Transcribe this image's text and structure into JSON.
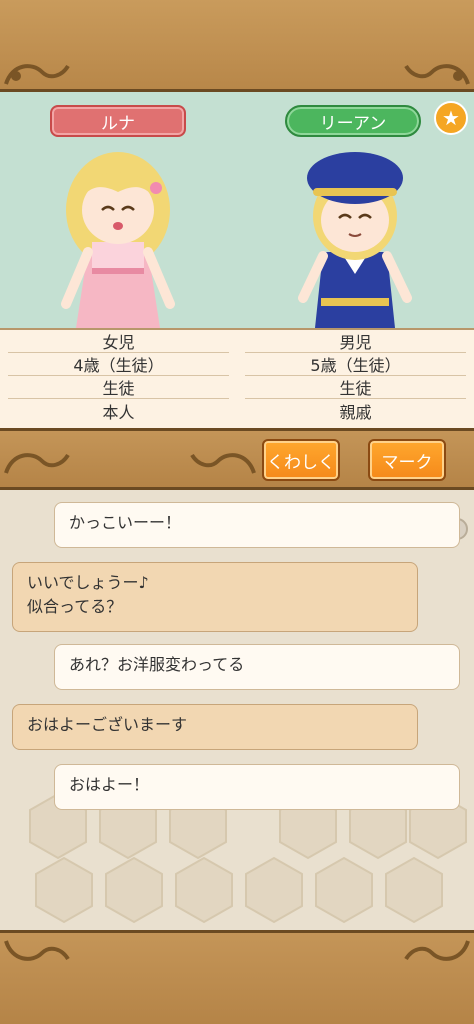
{
  "characters": [
    {
      "name": "ルナ",
      "info": [
        "女児",
        "4歳（生徒）",
        "生徒",
        "本人"
      ]
    },
    {
      "name": "リーアン",
      "badge_icon": "star-icon",
      "badge_symbol": "★",
      "info": [
        "男児",
        "5歳（生徒）",
        "生徒",
        "親戚"
      ]
    }
  ],
  "toolbar": {
    "details_label": "くわしく",
    "mark_label": "マーク"
  },
  "chat": {
    "messages": [
      {
        "text": "かっこいーー！",
        "style": "white"
      },
      {
        "text": "いいでしょうー♪\n似合ってる？",
        "line1": "いいでしょうー♪",
        "line2": "似合ってる？",
        "style": "tan"
      },
      {
        "text": "あれ？お洋服変わってる",
        "style": "white"
      },
      {
        "text": "おはよーございまーす",
        "style": "tan"
      },
      {
        "text": "おはよー！",
        "style": "white"
      }
    ]
  },
  "colors": {
    "frame": "#b88749",
    "portrait_bg": "#c4e0d2",
    "name_pink": "#e07171",
    "name_green": "#4cb65e",
    "button_orange": "#f5891a",
    "star": "#f5a623"
  }
}
